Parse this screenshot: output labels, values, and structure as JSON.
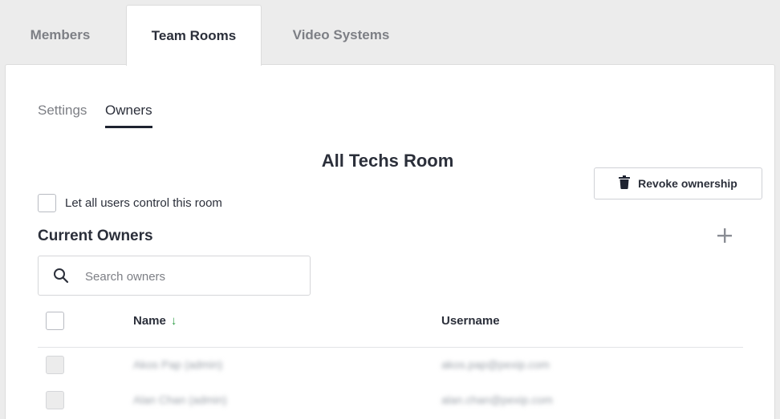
{
  "tabs": [
    {
      "label": "Members",
      "active": false
    },
    {
      "label": "Team Rooms",
      "active": true
    },
    {
      "label": "Video Systems",
      "active": false
    }
  ],
  "subtabs": [
    {
      "label": "Settings",
      "active": false
    },
    {
      "label": "Owners",
      "active": true
    }
  ],
  "room": {
    "title": "All Techs Room",
    "revoke_label": "Revoke ownership",
    "let_all_label": "Let all users control this room",
    "let_all_checked": false
  },
  "owners": {
    "section_title": "Current Owners",
    "search_placeholder": "Search owners",
    "columns": {
      "name": "Name",
      "username": "Username",
      "name_sort": "↓"
    },
    "rows": [
      {
        "name": "Akos Pap (admin)",
        "username": "akos.pap@pexip.com"
      },
      {
        "name": "Alan Chan (admin)",
        "username": "alan.chan@pexip.com"
      }
    ]
  },
  "colors": {
    "accent_dark": "#1e2330",
    "sort_green": "#2e9d46",
    "muted": "#7d7f85"
  }
}
